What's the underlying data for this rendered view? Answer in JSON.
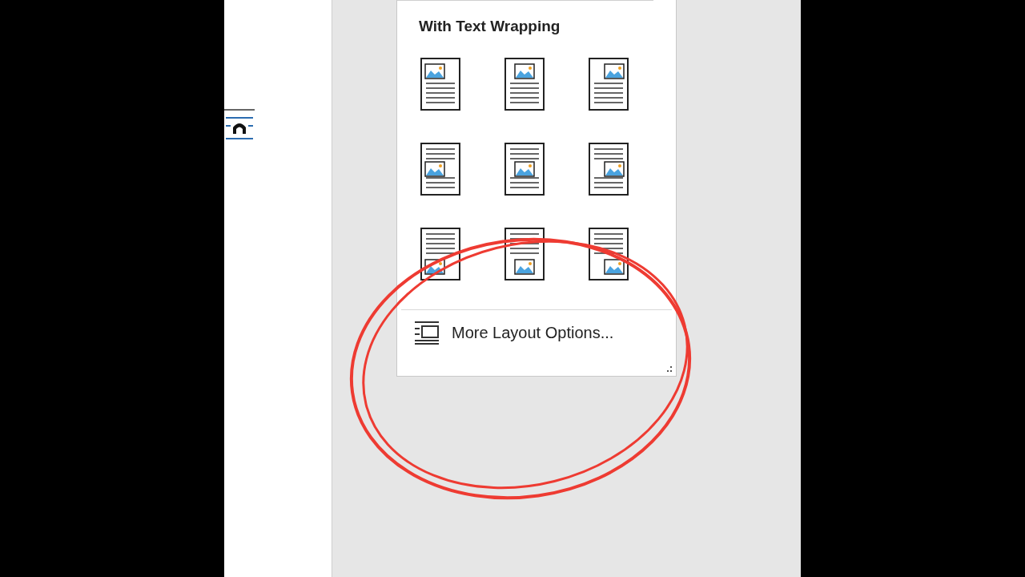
{
  "menu": {
    "heading": "With Text Wrapping",
    "options": [
      {
        "kind": "top-left"
      },
      {
        "kind": "top-center"
      },
      {
        "kind": "top-right"
      },
      {
        "kind": "middle-left"
      },
      {
        "kind": "middle-center"
      },
      {
        "kind": "middle-right"
      },
      {
        "kind": "bottom-left"
      },
      {
        "kind": "bottom-center"
      },
      {
        "kind": "bottom-right"
      }
    ],
    "more_label": "More Layout Options..."
  }
}
